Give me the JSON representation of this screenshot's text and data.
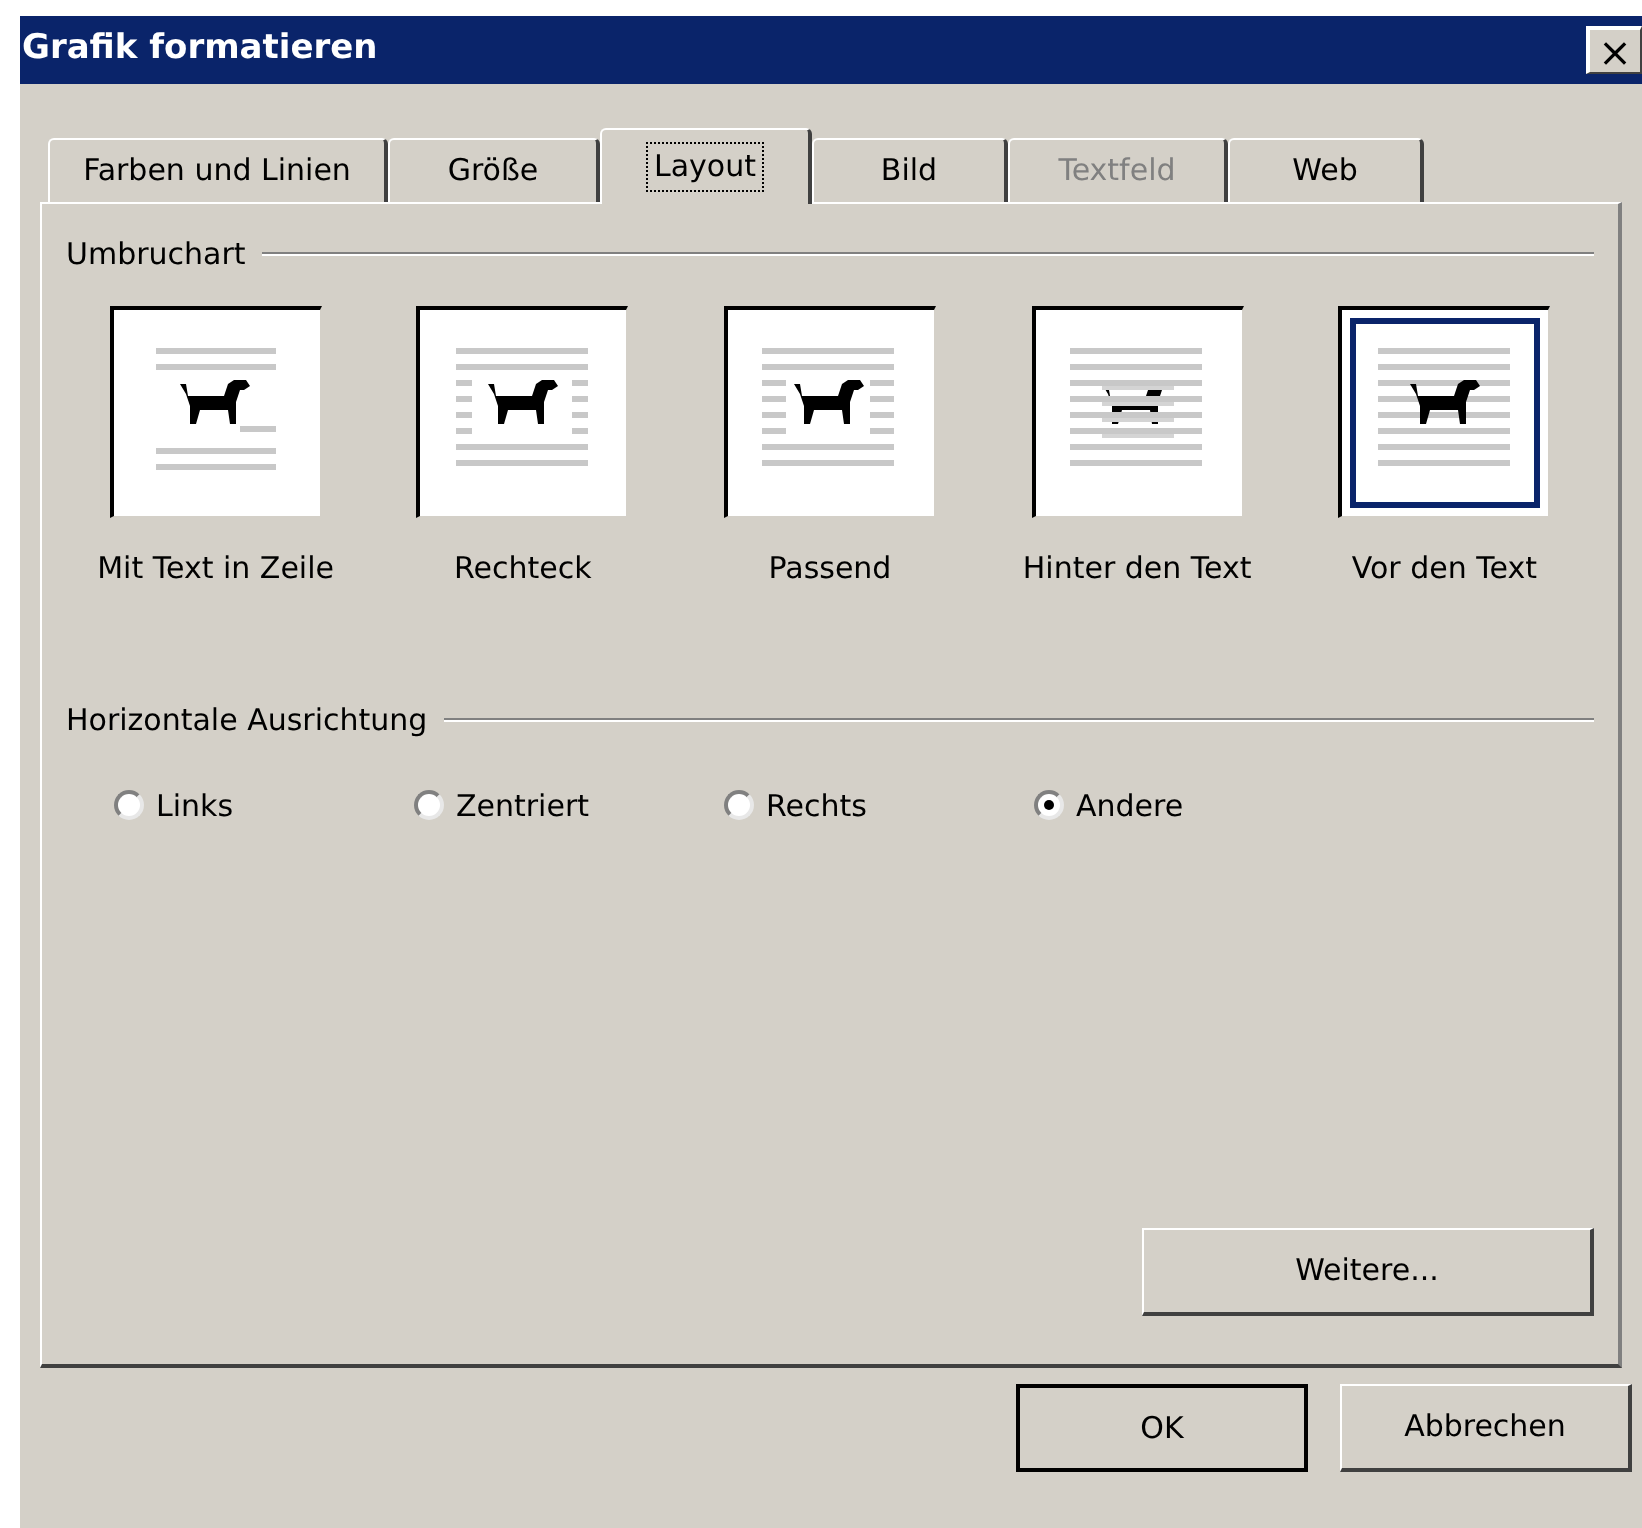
{
  "window": {
    "title": "Grafik formatieren",
    "close": "×"
  },
  "tabs": [
    {
      "label": "Farben und Linien",
      "selected": false,
      "disabled": false
    },
    {
      "label": "Größe",
      "selected": false,
      "disabled": false
    },
    {
      "label": "Layout",
      "selected": true,
      "disabled": false
    },
    {
      "label": "Bild",
      "selected": false,
      "disabled": false
    },
    {
      "label": "Textfeld",
      "selected": false,
      "disabled": true
    },
    {
      "label": "Web",
      "selected": false,
      "disabled": false
    }
  ],
  "wrap_section": {
    "title": "Umbruchart",
    "options": [
      {
        "label": "Mit Text in Zeile",
        "kind": "inline",
        "selected": false
      },
      {
        "label": "Rechteck",
        "kind": "square",
        "selected": false
      },
      {
        "label": "Passend",
        "kind": "tight",
        "selected": false
      },
      {
        "label": "Hinter den Text",
        "kind": "behind",
        "selected": false
      },
      {
        "label": "Vor den Text",
        "kind": "front",
        "selected": true
      }
    ]
  },
  "alignment_section": {
    "title": "Horizontale Ausrichtung",
    "options": [
      {
        "label": "Links",
        "selected": false
      },
      {
        "label": "Zentriert",
        "selected": false
      },
      {
        "label": "Rechts",
        "selected": false
      },
      {
        "label": "Andere",
        "selected": true
      }
    ]
  },
  "more_button": {
    "label": "Weitere..."
  },
  "buttons": [
    {
      "label": "OK",
      "default": true
    },
    {
      "label": "Abbrechen",
      "default": false
    }
  ]
}
